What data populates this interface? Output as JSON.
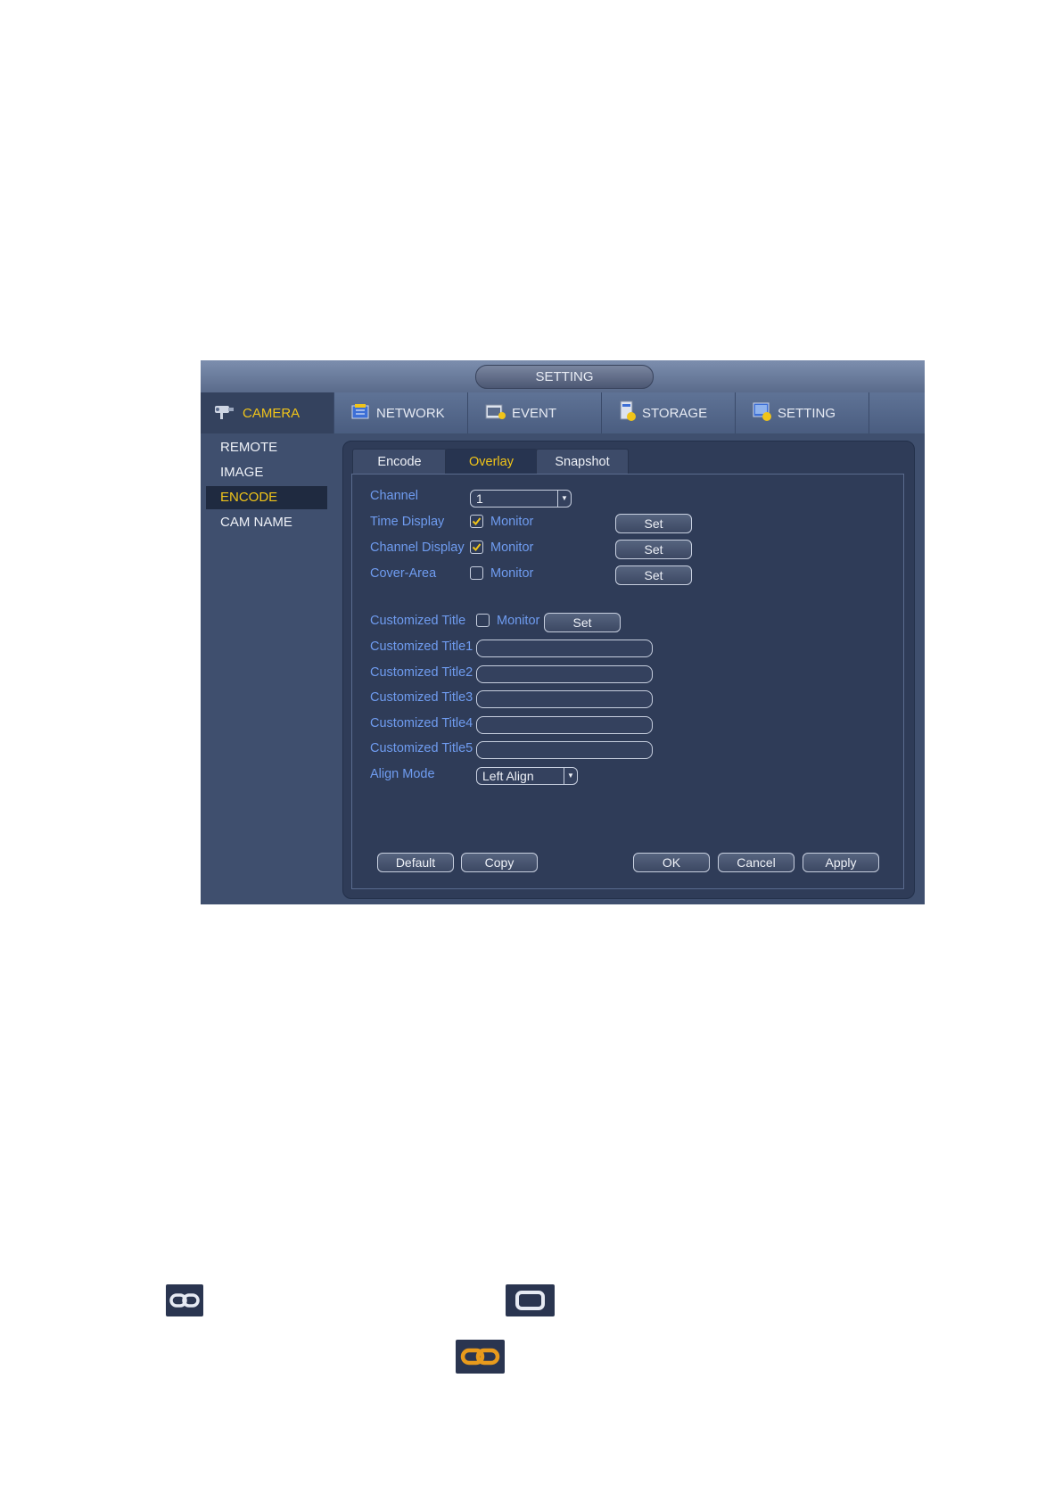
{
  "window": {
    "title": "SETTING"
  },
  "topnav": [
    {
      "label": "CAMERA",
      "icon": "camera-icon",
      "active": true
    },
    {
      "label": "NETWORK",
      "icon": "network-icon"
    },
    {
      "label": "EVENT",
      "icon": "event-icon"
    },
    {
      "label": "STORAGE",
      "icon": "storage-icon"
    },
    {
      "label": "SETTING",
      "icon": "setting-icon"
    }
  ],
  "sidebar": [
    {
      "label": "REMOTE"
    },
    {
      "label": "IMAGE"
    },
    {
      "label": "ENCODE",
      "active": true
    },
    {
      "label": "CAM NAME"
    }
  ],
  "subtabs": [
    {
      "label": "Encode"
    },
    {
      "label": "Overlay",
      "active": true
    },
    {
      "label": "Snapshot"
    }
  ],
  "form": {
    "channel_label": "Channel",
    "channel_value": "1",
    "time_display_label": "Time Display",
    "time_display_checked": true,
    "channel_display_label": "Channel Display",
    "channel_display_checked": true,
    "cover_area_label": "Cover-Area",
    "cover_area_checked": false,
    "monitor_label": "Monitor",
    "set_label": "Set",
    "customized_title_label": "Customized Title",
    "customized_title_checked": false,
    "title1_label": "Customized Title1",
    "title2_label": "Customized Title2",
    "title3_label": "Customized Title3",
    "title4_label": "Customized Title4",
    "title5_label": "Customized Title5",
    "align_mode_label": "Align Mode",
    "align_mode_value": "Left Align"
  },
  "buttons": {
    "default": "Default",
    "copy": "Copy",
    "ok": "OK",
    "cancel": "Cancel",
    "apply": "Apply"
  },
  "colors": {
    "accent_active": "#f0c419",
    "label_blue": "#6f9cf0",
    "link_icon_active": "#e89a1c"
  },
  "legend_icons": [
    "link-icon",
    "unlink-icon",
    "link-active-icon"
  ]
}
